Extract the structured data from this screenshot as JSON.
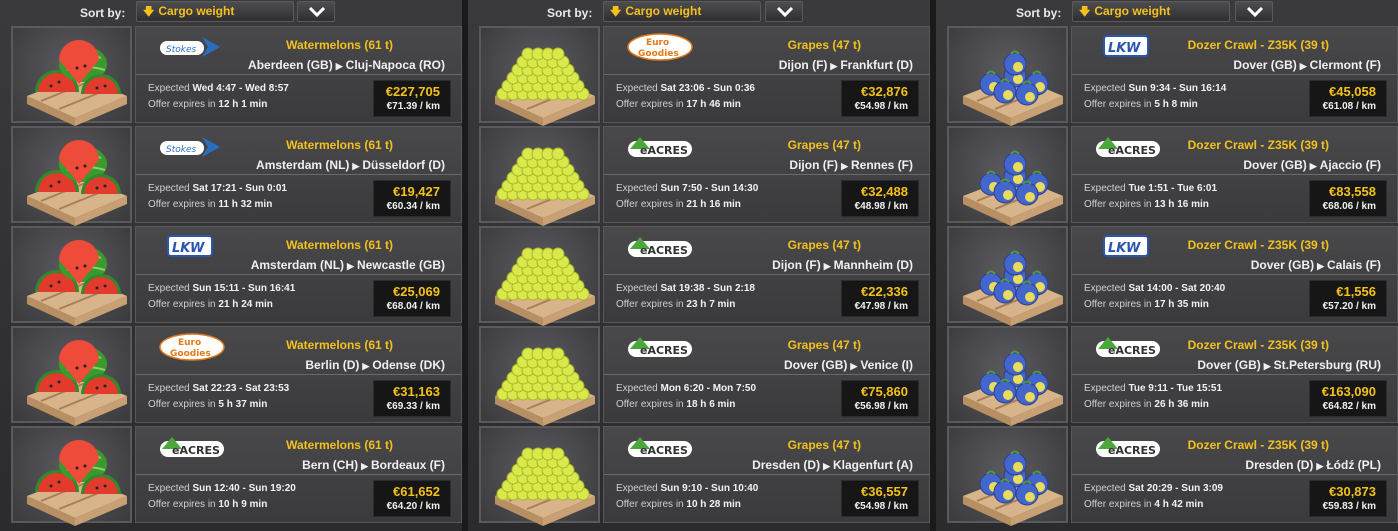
{
  "colors": {
    "accent": "#f4c11c",
    "background": "#1a1a1a",
    "panel": "#3a3a3c"
  },
  "sort": {
    "label": "Sort by:",
    "value": "Cargo weight",
    "arrow_icon": "arrow-down-icon",
    "toggle_icon": "chevron-down-icon"
  },
  "panels": [
    {
      "jobs": [
        {
          "company": "Stokes",
          "cargo": "Watermelons (61 t)",
          "origin": "Aberdeen (GB)",
          "destination": "Cluj-Napoca (RO)",
          "expected_label": "Expected",
          "expected": "Wed 4:47 - Wed 8:57",
          "expires_label": "Offer expires in",
          "expires": "12 h 1 min",
          "price": "€227,705",
          "per_km": "€71.39 / km"
        },
        {
          "company": "Stokes",
          "cargo": "Watermelons (61 t)",
          "origin": "Amsterdam (NL)",
          "destination": "Düsseldorf (D)",
          "expected_label": "Expected",
          "expected": "Sat 17:21 - Sun 0:01",
          "expires_label": "Offer expires in",
          "expires": "11 h 32 min",
          "price": "€19,427",
          "per_km": "€60.34 / km"
        },
        {
          "company": "LKW",
          "cargo": "Watermelons (61 t)",
          "origin": "Amsterdam (NL)",
          "destination": "Newcastle (GB)",
          "expected_label": "Expected",
          "expected": "Sun 15:11 - Sun 16:41",
          "expires_label": "Offer expires in",
          "expires": "21 h 24 min",
          "price": "€25,069",
          "per_km": "€68.04 / km"
        },
        {
          "company": "Euro Goodies",
          "cargo": "Watermelons (61 t)",
          "origin": "Berlin (D)",
          "destination": "Odense (DK)",
          "expected_label": "Expected",
          "expected": "Sat 22:23 - Sat 23:53",
          "expires_label": "Offer expires in",
          "expires": "5 h 37 min",
          "price": "€31,163",
          "per_km": "€69.33 / km"
        },
        {
          "company": "eAcres",
          "cargo": "Watermelons (61 t)",
          "origin": "Bern (CH)",
          "destination": "Bordeaux (F)",
          "expected_label": "Expected",
          "expected": "Sun 12:40 - Sun 19:20",
          "expires_label": "Offer expires in",
          "expires": "10 h 9 min",
          "price": "€61,652",
          "per_km": "€64.20 / km"
        }
      ]
    },
    {
      "jobs": [
        {
          "company": "Euro Goodies",
          "cargo": "Grapes (47 t)",
          "origin": "Dijon (F)",
          "destination": "Frankfurt (D)",
          "expected_label": "Expected",
          "expected": "Sat 23:06 - Sun 0:36",
          "expires_label": "Offer expires in",
          "expires": "17 h 46 min",
          "price": "€32,876",
          "per_km": "€54.98 / km"
        },
        {
          "company": "eAcres",
          "cargo": "Grapes (47 t)",
          "origin": "Dijon (F)",
          "destination": "Rennes (F)",
          "expected_label": "Expected",
          "expected": "Sun 7:50 - Sun 14:30",
          "expires_label": "Offer expires in",
          "expires": "21 h 16 min",
          "price": "€32,488",
          "per_km": "€48.98 / km"
        },
        {
          "company": "eAcres",
          "cargo": "Grapes (47 t)",
          "origin": "Dijon (F)",
          "destination": "Mannheim (D)",
          "expected_label": "Expected",
          "expected": "Sat 19:38 - Sun 2:18",
          "expires_label": "Offer expires in",
          "expires": "23 h 7 min",
          "price": "€22,336",
          "per_km": "€47.98 / km"
        },
        {
          "company": "eAcres",
          "cargo": "Grapes (47 t)",
          "origin": "Dover (GB)",
          "destination": "Venice (I)",
          "expected_label": "Expected",
          "expected": "Mon 6:20 - Mon 7:50",
          "expires_label": "Offer expires in",
          "expires": "18 h 6 min",
          "price": "€75,860",
          "per_km": "€56.98 / km"
        },
        {
          "company": "eAcres",
          "cargo": "Grapes (47 t)",
          "origin": "Dresden (D)",
          "destination": "Klagenfurt (A)",
          "expected_label": "Expected",
          "expected": "Sun 9:10 - Sun 10:40",
          "expires_label": "Offer expires in",
          "expires": "10 h 28 min",
          "price": "€36,557",
          "per_km": "€54.98 / km"
        }
      ]
    },
    {
      "jobs": [
        {
          "company": "LKW",
          "cargo": "Dozer Crawl - Z35K (39 t)",
          "origin": "Dover (GB)",
          "destination": "Clermont (F)",
          "expected_label": "Expected",
          "expected": "Sun 9:34 - Sun 16:14",
          "expires_label": "Offer expires in",
          "expires": "5 h 8 min",
          "price": "€45,058",
          "per_km": "€61.08 / km"
        },
        {
          "company": "eAcres",
          "cargo": "Dozer Crawl - Z35K (39 t)",
          "origin": "Dover (GB)",
          "destination": "Ajaccio (F)",
          "expected_label": "Expected",
          "expected": "Tue 1:51 - Tue 6:01",
          "expires_label": "Offer expires in",
          "expires": "13 h 16 min",
          "price": "€83,558",
          "per_km": "€68.06 / km"
        },
        {
          "company": "LKW",
          "cargo": "Dozer Crawl - Z35K (39 t)",
          "origin": "Dover (GB)",
          "destination": "Calais (F)",
          "expected_label": "Expected",
          "expected": "Sat 14:00 - Sat 20:40",
          "expires_label": "Offer expires in",
          "expires": "17 h 35 min",
          "price": "€1,556",
          "per_km": "€57.20 / km"
        },
        {
          "company": "eAcres",
          "cargo": "Dozer Crawl - Z35K (39 t)",
          "origin": "Dover (GB)",
          "destination": "St.Petersburg (RU)",
          "expected_label": "Expected",
          "expected": "Tue 9:11 - Tue 15:51",
          "expires_label": "Offer expires in",
          "expires": "26 h 36 min",
          "price": "€163,090",
          "per_km": "€64.82 / km"
        },
        {
          "company": "eAcres",
          "cargo": "Dozer Crawl - Z35K (39 t)",
          "origin": "Dresden (D)",
          "destination": "Łódź (PL)",
          "expected_label": "Expected",
          "expected": "Sat 20:29 - Sun 3:09",
          "expires_label": "Offer expires in",
          "expires": "4 h 42 min",
          "price": "€30,873",
          "per_km": "€59.83 / km"
        }
      ]
    }
  ]
}
